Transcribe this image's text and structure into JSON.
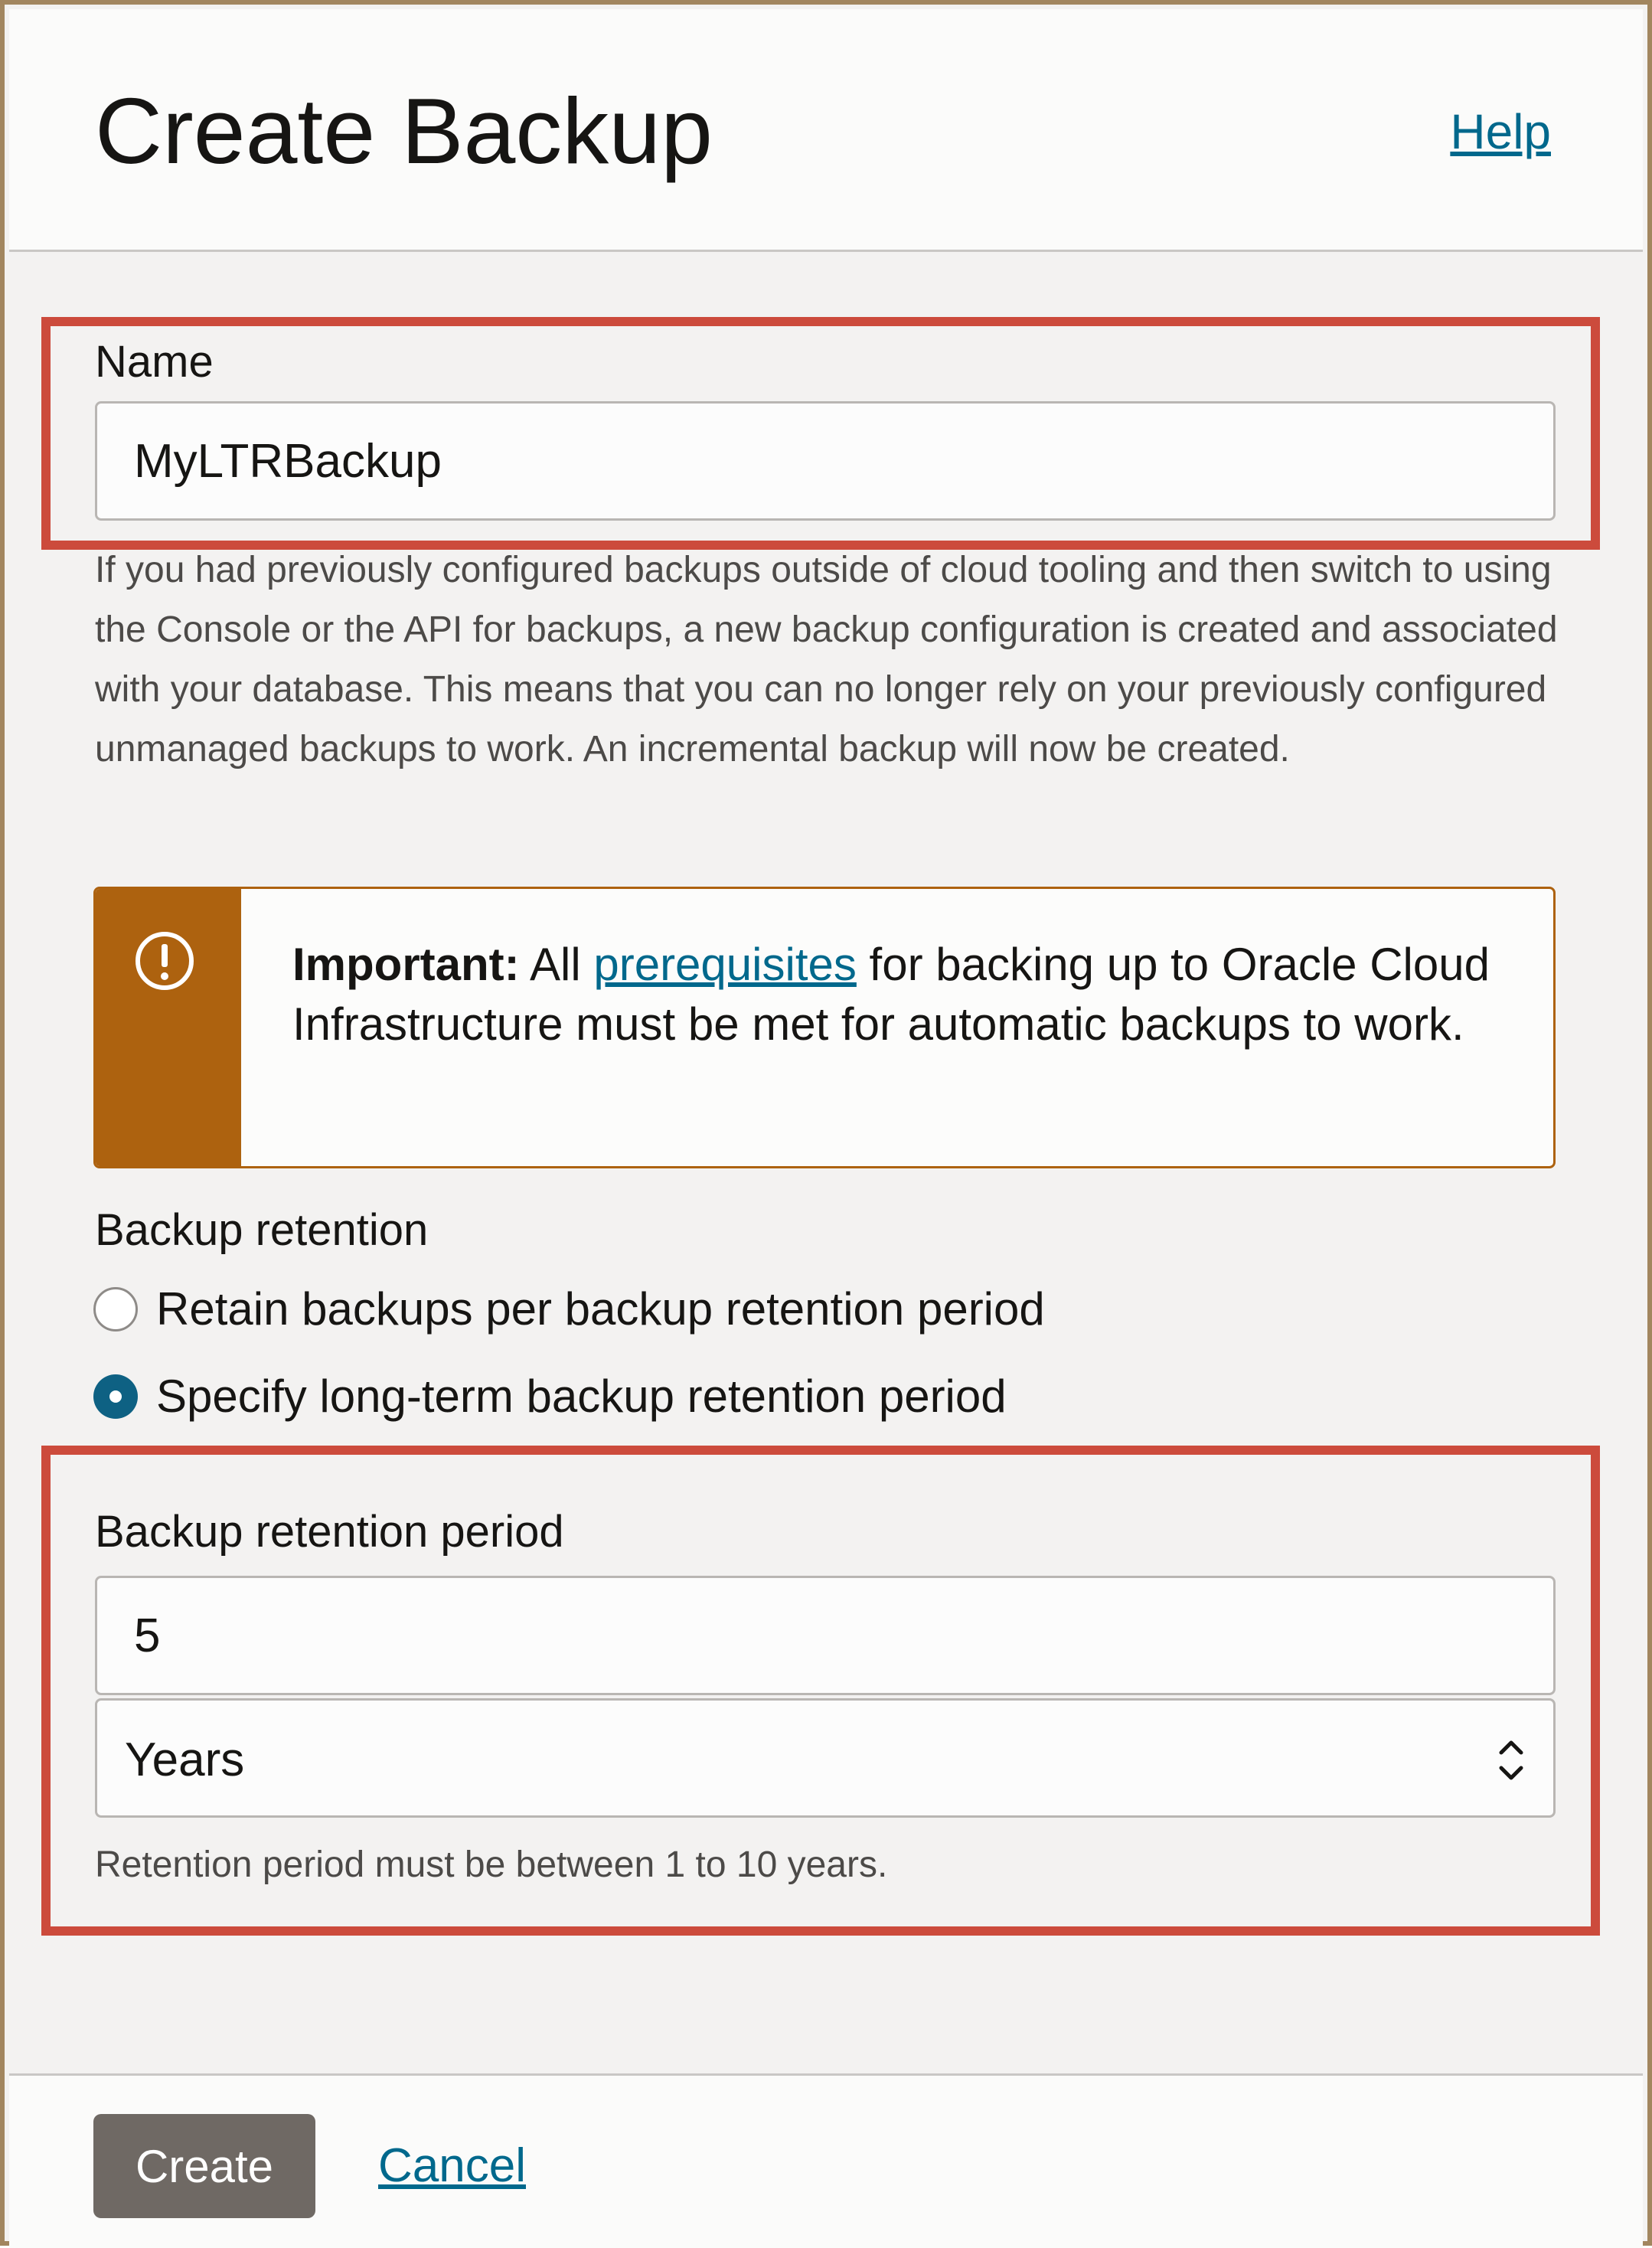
{
  "dialog": {
    "title": "Create Backup",
    "help_link": "Help"
  },
  "name_field": {
    "label": "Name",
    "value": "MyLTRBackup"
  },
  "help_text": "If you had previously configured backups outside of cloud tooling and then switch to using the Console or the API for backups, a new backup configuration is created and associated with your database. This means that you can no longer rely on your previously configured unmanaged backups to work. An incremental backup will now be created.",
  "alert": {
    "icon": "exclamation-circle-icon",
    "strong": "Important:",
    "before_link": "All",
    "link": "prerequisites",
    "after_link": "for backing up to Oracle Cloud Infrastructure must be met for automatic backups to work."
  },
  "retention": {
    "label": "Backup retention",
    "options": [
      {
        "label": "Retain backups per backup retention period",
        "checked": false
      },
      {
        "label": "Specify long-term backup retention period",
        "checked": true
      }
    ]
  },
  "retention_period": {
    "label": "Backup retention period",
    "value": "5",
    "unit": "Years",
    "hint": "Retention period must be between 1 to 10 years."
  },
  "footer": {
    "create_label": "Create",
    "cancel_label": "Cancel"
  },
  "colors": {
    "accent": "#00688c",
    "highlight": "#cc4b3c",
    "warning": "#ad620f",
    "button": "#6f6964"
  }
}
